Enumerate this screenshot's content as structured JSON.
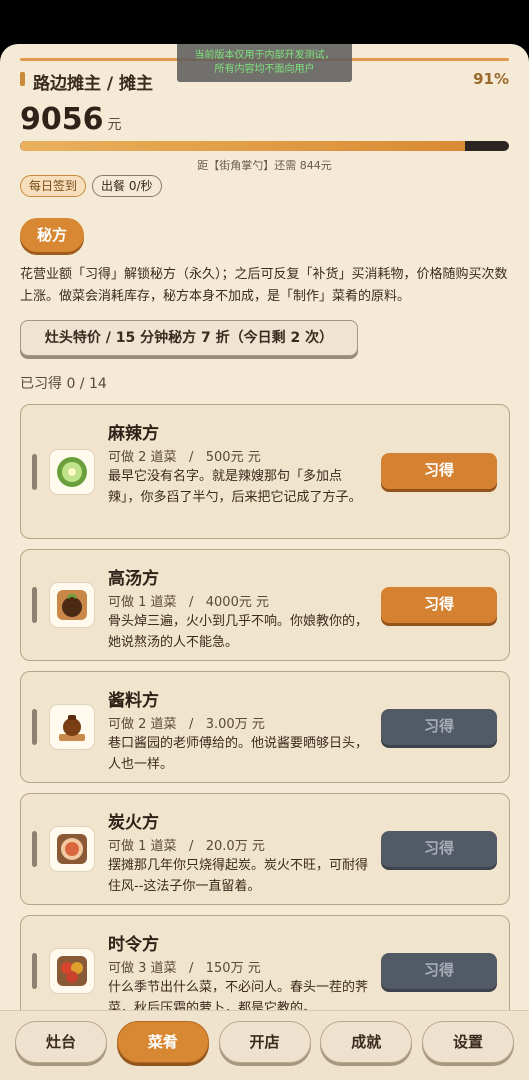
{
  "dev_banner": [
    "当前版本仅用于内部开发测试，",
    "所有内容均不面向用户"
  ],
  "header": {
    "title": "路边摊主 / 摊主",
    "percent": "91%",
    "money": "9056",
    "money_unit": "元",
    "progress": 0.91,
    "progress_note": "距【街角掌勺】还需 844元"
  },
  "chips": {
    "daily_checkin": "每日签到",
    "serve_rate": "出餐 0/秒"
  },
  "section": {
    "tag": "秘方",
    "description": "花营业额「习得」解锁秘方（永久）；之后可反复「补货」买消耗物，价格随购买次数上涨。做菜会消耗库存，秘方本身不加成，是「制作」菜肴的原料。",
    "special_offer": "灶头特价 / 15 分钟秘方 7 折（今日剩 2 次）",
    "learned_count": "已习得 0 / 14"
  },
  "recipes": [
    {
      "name": "麻辣方",
      "dishes": "可做 2 道菜",
      "sep": "/",
      "price": "500元 元",
      "text": "最早它没有名字。就是辣嫂那句「多加点辣」，你多舀了半勺，后来把它记成了方子。",
      "button": "习得",
      "enabled": true,
      "icon": "pepper-bowl-icon",
      "color": "#8fbf5a"
    },
    {
      "name": "高汤方",
      "dishes": "可做 1 道菜",
      "sep": "/",
      "price": "4000元 元",
      "text": "骨头焯三遍，火小到几乎不响。你娘教你的，她说熬汤的人不能急。",
      "button": "习得",
      "enabled": true,
      "icon": "soup-pot-icon",
      "color": "#8a5a2a"
    },
    {
      "name": "酱料方",
      "dishes": "可做 2 道菜",
      "sep": "/",
      "price": "3.00万 元",
      "text": "巷口酱园的老师傅给的。他说酱要晒够日头，人也一样。",
      "button": "习得",
      "enabled": false,
      "icon": "sauce-jar-icon",
      "color": "#b0702e"
    },
    {
      "name": "炭火方",
      "dishes": "可做 1 道菜",
      "sep": "/",
      "price": "20.0万 元",
      "text": "摆摊那几年你只烧得起炭。炭火不旺，可耐得住风--这法子你一直留着。",
      "button": "习得",
      "enabled": false,
      "icon": "charcoal-plate-icon",
      "color": "#c76a45"
    },
    {
      "name": "时令方",
      "dishes": "可做 3 道菜",
      "sep": "/",
      "price": "150万 元",
      "text": "什么季节出什么菜，不必问人。春头一茬的荠菜，秋后压霜的萝卜，都是它教的。",
      "button": "习得",
      "enabled": false,
      "icon": "seasonal-veg-icon",
      "color": "#c9442e"
    }
  ],
  "nav": [
    "灶台",
    "菜肴",
    "开店",
    "成就",
    "设置"
  ],
  "nav_active": 1
}
